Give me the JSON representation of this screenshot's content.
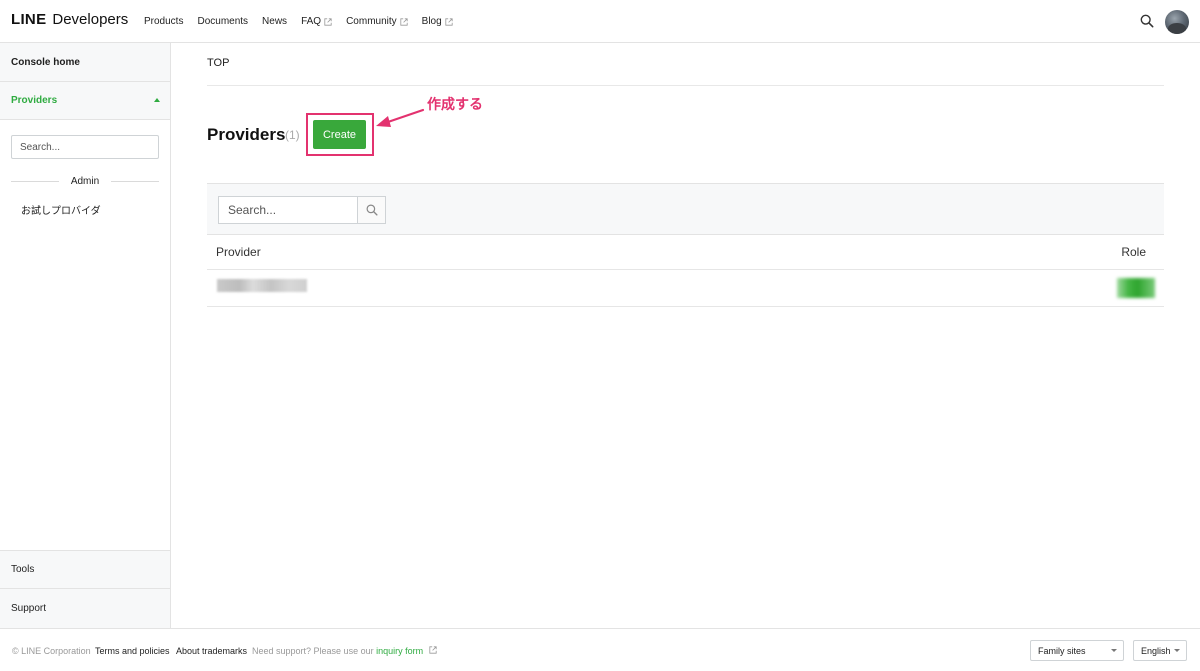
{
  "header": {
    "logo_bold": "LINE",
    "logo_light": "Developers",
    "nav": [
      {
        "label": "Products",
        "external": false
      },
      {
        "label": "Documents",
        "external": false
      },
      {
        "label": "News",
        "external": false
      },
      {
        "label": "FAQ",
        "external": true
      },
      {
        "label": "Community",
        "external": true
      },
      {
        "label": "Blog",
        "external": true
      }
    ],
    "search_icon": "search-icon",
    "avatar": "user-avatar"
  },
  "sidebar": {
    "console_home": "Console home",
    "providers": "Providers",
    "search_placeholder": "Search...",
    "group_label": "Admin",
    "provider_item": "お試しプロバイダ",
    "tools": "Tools",
    "support": "Support"
  },
  "main": {
    "breadcrumb": "TOP",
    "title": "Providers",
    "count": "(1)",
    "create_label": "Create",
    "annotation": "作成する",
    "table_search_placeholder": "Search...",
    "columns": {
      "provider": "Provider",
      "role": "Role"
    }
  },
  "footer": {
    "copyright": "© LINE Corporation",
    "terms": "Terms and policies",
    "trademarks": "About trademarks",
    "support_prefix": "Need support? Please use our ",
    "inquiry_link": "inquiry form",
    "family_sites": "Family sites",
    "language": "English"
  },
  "colors": {
    "accent_green": "#39a83b",
    "link_green": "#2fab41",
    "annotation_pink": "#e3326f"
  }
}
